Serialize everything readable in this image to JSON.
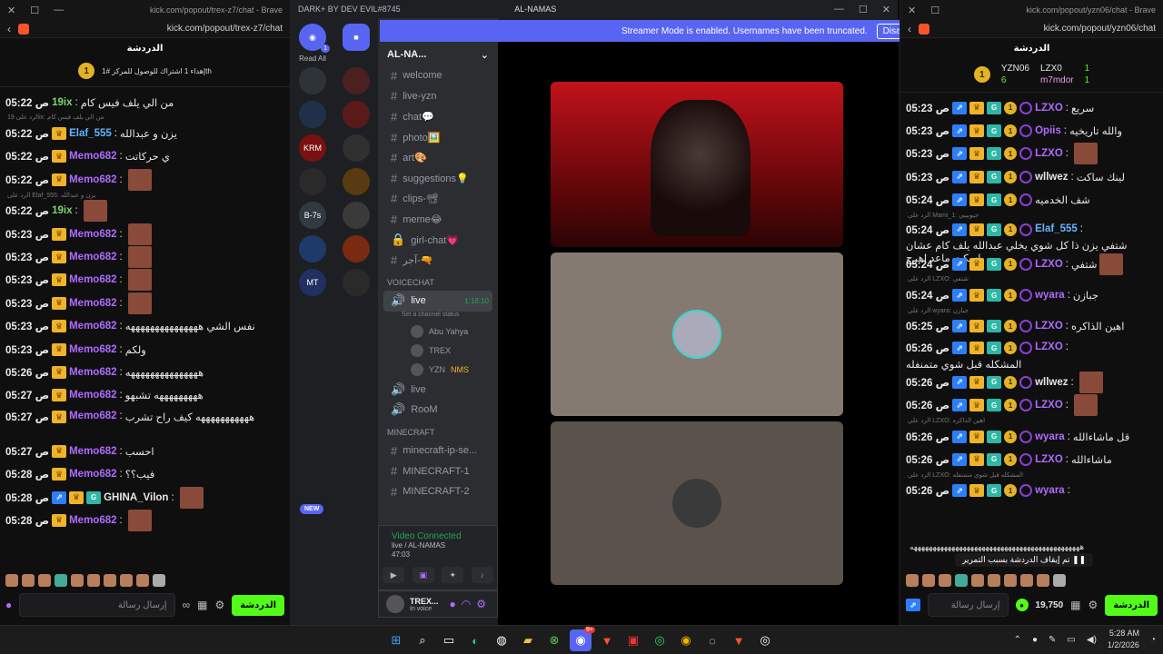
{
  "left_window": {
    "title": "kick.com/popout/trex-z7/chat - Brave",
    "url": "kick.com/popout/trex-z7/chat",
    "chat_title": "الدردشة",
    "pinned_count": "1",
    "pinned_text": "إهداء 1 اشتراك للوصول للمركز #1th",
    "input_placeholder": "إرسال رسالة",
    "send_label": "الدردشة",
    "messages": [
      {
        "time": "05:22 ص",
        "user": "19ix",
        "color": "green",
        "text": "من الي يلف فيس كام",
        "badges": []
      },
      {
        "reply": "الرد على 19ix: من الي يلف فيس كام",
        "time": "05:22 ص",
        "user": "Elaf_555",
        "color": "blue",
        "text": "يزن و عبدالله",
        "badges": [
          "crown"
        ]
      },
      {
        "time": "05:22 ص",
        "user": "Memo682",
        "color": "purple",
        "text": "ي حركاتت",
        "badges": [
          "crown"
        ]
      },
      {
        "time": "05:22 ص",
        "user": "Memo682",
        "color": "purple",
        "text": "",
        "badges": [
          "crown"
        ],
        "emote": true
      },
      {
        "reply": "الرد على Elaf_555: يزن و عبدالله",
        "time": "05:22 ص",
        "user": "19ix",
        "color": "green",
        "text": "",
        "badges": [],
        "emote": true
      },
      {
        "time": "05:23 ص",
        "user": "Memo682",
        "color": "purple",
        "text": "",
        "badges": [
          "crown"
        ],
        "emote": true
      },
      {
        "time": "05:23 ص",
        "user": "Memo682",
        "color": "purple",
        "text": "",
        "badges": [
          "crown"
        ],
        "emote": true
      },
      {
        "time": "05:23 ص",
        "user": "Memo682",
        "color": "purple",
        "text": "",
        "badges": [
          "crown"
        ],
        "emote": true
      },
      {
        "time": "05:23 ص",
        "user": "Memo682",
        "color": "purple",
        "text": "",
        "badges": [
          "crown"
        ],
        "emote": true
      },
      {
        "time": "05:23 ص",
        "user": "Memo682",
        "color": "purple",
        "text": "نفس الشي هههههههههههههههه",
        "badges": [
          "crown"
        ]
      },
      {
        "time": "05:23 ص",
        "user": "Memo682",
        "color": "purple",
        "text": "ولكم",
        "badges": [
          "crown"
        ]
      },
      {
        "time": "05:26 ص",
        "user": "Memo682",
        "color": "purple",
        "text": "هههههههههههههههه",
        "badges": [
          "crown"
        ]
      },
      {
        "time": "05:27 ص",
        "user": "Memo682",
        "color": "purple",
        "text": "هههههههههه تشبهو",
        "badges": [
          "crown"
        ]
      },
      {
        "time": "05:27 ص",
        "user": "Memo682",
        "color": "purple",
        "text": "هههههههههههه كيف راح تشرب",
        "badges": [
          "crown"
        ],
        "tall": true
      },
      {
        "time": "05:27 ص",
        "user": "Memo682",
        "color": "purple",
        "text": "احسب",
        "badges": [
          "crown"
        ]
      },
      {
        "time": "05:28 ص",
        "user": "Memo682",
        "color": "purple",
        "text": "فيب؟؟",
        "badges": [
          "crown"
        ]
      },
      {
        "time": "05:28 ص",
        "user": "GHINA_Vilon",
        "color": "white",
        "text": "",
        "badges": [
          "blue",
          "crown",
          "gem"
        ],
        "emote": true
      },
      {
        "time": "05:28 ص",
        "user": "Memo682",
        "color": "purple",
        "text": "",
        "badges": [
          "crown"
        ],
        "emote": true
      }
    ]
  },
  "discord": {
    "app_title": "DARK+ BY DEV EVIL#8745",
    "window_title": "AL-NAMAS",
    "banner_text": "Streamer Mode is enabled. Usernames have been truncated.",
    "banner_button": "Disable",
    "read_all": "Read All",
    "server_name": "AL-NA...",
    "new_label": "NEW",
    "guild_labels": [
      "",
      "",
      "",
      "",
      "KRM",
      "",
      "",
      "",
      "B-7s",
      "",
      "",
      "",
      "MT",
      ""
    ],
    "channels": [
      {
        "name": "welcome",
        "icon": "#"
      },
      {
        "name": "live-yzn",
        "icon": "#"
      },
      {
        "name": "chat💬",
        "icon": "#"
      },
      {
        "name": "photo🖼️",
        "icon": "#"
      },
      {
        "name": "art🎨",
        "icon": "#"
      },
      {
        "name": "suggestions💡",
        "icon": "#"
      },
      {
        "name": "clips-📽",
        "icon": "#"
      },
      {
        "name": "meme😂",
        "icon": "#"
      },
      {
        "name": "girl-chat💗",
        "icon": "🔒"
      },
      {
        "name": "آجر-🔫",
        "icon": "#"
      }
    ],
    "voice_category": "VOICECHAT",
    "voice_channel": {
      "name": "live",
      "timer": "1:16:10",
      "status": "Set a channel status"
    },
    "voice_users": [
      "Abu Yahya",
      "TREX",
      "YZN"
    ],
    "voice_user_tag": "NMS",
    "voice_channels_more": [
      "live",
      "RooM"
    ],
    "minecraft_category": "MINECRAFT",
    "minecraft_channels": [
      "minecraft-ip-se...",
      "MINECRAFT-1",
      "MINECRAFT-2"
    ],
    "vc_status": "Video Connected",
    "vc_location": "live / AL-NAMAS",
    "vc_time": "47:03",
    "me_name": "TREX...",
    "me_status": "In voice"
  },
  "right_window": {
    "url": "kick.com/popout/yzn06/chat",
    "chat_title": "الدردشة",
    "header_users": [
      "YZN06",
      "LZX0",
      "m7mdor"
    ],
    "header_counts": [
      "6",
      "1",
      "1"
    ],
    "input_placeholder": "إرسال رسالة",
    "points": "19,750",
    "send_label": "الدردشة",
    "messages": [
      {
        "time": "05:23 ص",
        "user": "LZXO",
        "color": "purple",
        "text": "سريع"
      },
      {
        "time": "05:23 ص",
        "user": "Opiis",
        "color": "purple",
        "text": "والله تاريخيه"
      },
      {
        "time": "05:23 ص",
        "user": "LZXO",
        "color": "purple",
        "text": "",
        "emote": true
      },
      {
        "time": "05:23 ص",
        "user": "wllwez",
        "color": "white",
        "text": "لينك ساكت"
      },
      {
        "time": "05:24 ص",
        "user": "",
        "color": "white",
        "text": "شف الخدميه"
      },
      {
        "reply": "الرد على Mami_1: جيوبيبي",
        "time": "05:24 ص",
        "user": "Elaf_555",
        "color": "blue",
        "text": "شتفي يزن ذا كل شوي يخلي عبدالله يلف كام عشان اسكت ماعد اهرج",
        "tall": true
      },
      {
        "time": "05:24 ص",
        "user": "LZXO",
        "color": "purple",
        "text": "شتفي",
        "emote": true
      },
      {
        "reply": "الرد على LZXO: شتفي",
        "time": "05:24 ص",
        "user": "wyara",
        "color": "purple",
        "text": "جبازن"
      },
      {
        "reply": "الرد على wyara: جبازن",
        "time": "05:25 ص",
        "user": "LZXO",
        "color": "purple",
        "text": "اهين الذاكره"
      },
      {
        "time": "05:26 ص",
        "user": "LZXO",
        "color": "purple",
        "text": "المشكله قبل شوي متمنفله",
        "tall": true
      },
      {
        "time": "05:26 ص",
        "user": "wllwez",
        "color": "white",
        "text": "",
        "emote": true
      },
      {
        "time": "05:26 ص",
        "user": "LZXO",
        "color": "purple",
        "text": "",
        "emote": true
      },
      {
        "reply": "الرد على LZXO: اهين الذاكره",
        "time": "05:26 ص",
        "user": "wyara",
        "color": "purple",
        "text": "قل ماشاءالله"
      },
      {
        "time": "05:26 ص",
        "user": "LZXO",
        "color": "purple",
        "text": "ماشاءالله"
      },
      {
        "reply": "الرد على LZXO: المشكله قبل شوي متمنفله",
        "time": "05:26 ص",
        "user": "wyara",
        "color": "purple",
        "text": ""
      }
    ],
    "long_laugh": "هههههههههههههههههههههههههههههههههههههههههههههه",
    "paused_label": "تم إيقاف الدردشة بسبب التمرير"
  },
  "taskbar": {
    "time": "5:28 AM",
    "date": "1/2/2026",
    "discord_badge": "9+"
  }
}
